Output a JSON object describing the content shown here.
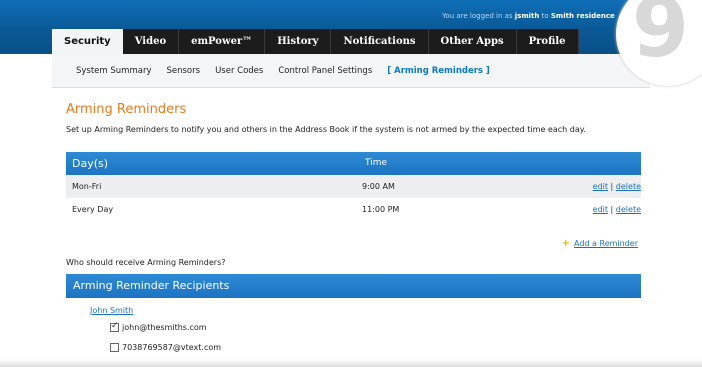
{
  "header": {
    "login_prefix": "You are logged in as",
    "username": "jsmith",
    "login_to": "to",
    "residence": "Smith residence",
    "power_glyph": "○"
  },
  "tabs": [
    {
      "label": "Security",
      "active": true
    },
    {
      "label": "Video"
    },
    {
      "label": "emPower™"
    },
    {
      "label": "History"
    },
    {
      "label": "Notifications"
    },
    {
      "label": "Other Apps"
    },
    {
      "label": "Profile"
    }
  ],
  "subnav": [
    {
      "label": "System Summary"
    },
    {
      "label": "Sensors"
    },
    {
      "label": "User Codes"
    },
    {
      "label": "Control Panel Settings"
    },
    {
      "label": "[ Arming Reminders ]",
      "active": true
    }
  ],
  "badge": "9",
  "page": {
    "title": "Arming Reminders",
    "description": "Set up Arming Reminders to notify you and others in the Address Book if the system is not armed by the expected time each day."
  },
  "reminders": {
    "headers": {
      "day": "Day(s)",
      "time": "Time"
    },
    "rows": [
      {
        "day": "Mon-Fri",
        "time": "9:00 AM",
        "edit": "edit",
        "sep": "|",
        "delete": "delete"
      },
      {
        "day": "Every Day",
        "time": "11:00 PM",
        "edit": "edit",
        "sep": "|",
        "delete": "delete"
      }
    ],
    "add_plus": "+",
    "add_label": "Add a Reminder"
  },
  "question": "Who should receive Arming Reminders?",
  "recipients": {
    "header": "Arming Reminder Recipients",
    "contact": "John Smith",
    "items": [
      {
        "label": "john@thesmiths.com",
        "checked": true
      },
      {
        "label": "7038769587@vtext.com",
        "checked": false
      }
    ]
  }
}
